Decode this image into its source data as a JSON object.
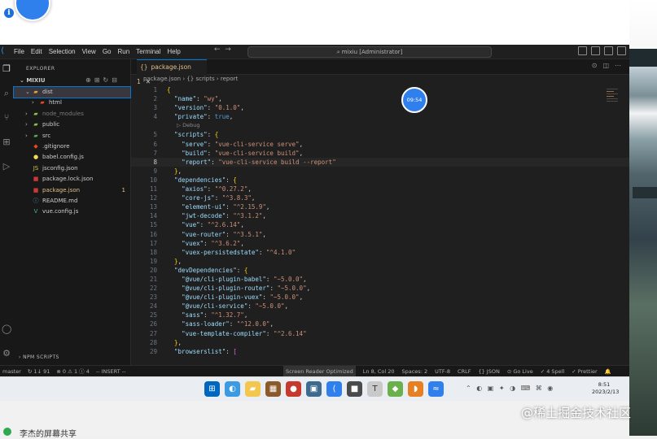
{
  "window": {
    "title": "mixiu [Administrator]",
    "menu": [
      "File",
      "Edit",
      "Selection",
      "View",
      "Go",
      "Run",
      "Terminal",
      "Help"
    ]
  },
  "sidebar": {
    "header": "EXPLORER",
    "folder": "MIXIU",
    "tree": [
      {
        "label": "dist",
        "chev": "⌄",
        "icon": "▰",
        "icon_color": "#e8a33d",
        "indent": 1,
        "active": true
      },
      {
        "label": "html",
        "chev": "›",
        "icon": "▰",
        "icon_color": "#e44d26",
        "indent": 2
      },
      {
        "label": "node_modules",
        "chev": "›",
        "icon": "▰",
        "icon_color": "#8bc34a",
        "indent": 1,
        "dim": true
      },
      {
        "label": "public",
        "chev": "›",
        "icon": "▰",
        "icon_color": "#8bc34a",
        "indent": 1
      },
      {
        "label": "src",
        "chev": "›",
        "icon": "▰",
        "icon_color": "#4caf50",
        "indent": 1
      },
      {
        "label": ".gitignore",
        "chev": "",
        "icon": "◆",
        "icon_color": "#e64a19",
        "indent": 1
      },
      {
        "label": "babel.config.js",
        "chev": "",
        "icon": "●",
        "icon_color": "#f5da55",
        "indent": 1
      },
      {
        "label": "jsconfig.json",
        "chev": "",
        "icon": "JS",
        "icon_color": "#cbcb41",
        "indent": 1
      },
      {
        "label": "package.lock.json",
        "chev": "",
        "icon": "■",
        "icon_color": "#cb3837",
        "indent": 1
      },
      {
        "label": "package.json",
        "chev": "",
        "icon": "■",
        "icon_color": "#cb3837",
        "indent": 1,
        "badge": "1",
        "modified": true
      },
      {
        "label": "README.md",
        "chev": "",
        "icon": "ⓘ",
        "icon_color": "#519aba",
        "indent": 1
      },
      {
        "label": "vue.config.js",
        "chev": "",
        "icon": "V",
        "icon_color": "#41b883",
        "indent": 1
      }
    ],
    "npm_scripts": "NPM SCRIPTS"
  },
  "editor": {
    "tab_label": "package.json 1",
    "breadcrumb": [
      "package.json",
      "{} scripts",
      "report"
    ],
    "timer": "09:54",
    "lines": [
      {
        "n": "1",
        "t": "{"
      },
      {
        "n": "2",
        "t": "  \"name\": \"wy\","
      },
      {
        "n": "3",
        "t": "  \"version\": \"0.1.0\","
      },
      {
        "n": "4",
        "t": "  \"private\": true,"
      },
      {
        "n": "",
        "t": "▷ Debug",
        "lens": true
      },
      {
        "n": "5",
        "t": "  \"scripts\": {"
      },
      {
        "n": "6",
        "t": "    \"serve\": \"vue-cli-service serve\","
      },
      {
        "n": "7",
        "t": "    \"build\": \"vue-cli-service build\","
      },
      {
        "n": "8",
        "t": "    \"report\": \"vue-cli-service build --report\"",
        "cur": true
      },
      {
        "n": "9",
        "t": "  },"
      },
      {
        "n": "10",
        "t": "  \"dependencies\": {"
      },
      {
        "n": "11",
        "t": "    \"axios\": \"^0.27.2\","
      },
      {
        "n": "12",
        "t": "    \"core-js\": \"^3.8.3\","
      },
      {
        "n": "13",
        "t": "    \"element-ui\": \"^2.15.9\","
      },
      {
        "n": "14",
        "t": "    \"jwt-decode\": \"^3.1.2\","
      },
      {
        "n": "15",
        "t": "    \"vue\": \"^2.6.14\","
      },
      {
        "n": "16",
        "t": "    \"vue-router\": \"^3.5.1\","
      },
      {
        "n": "17",
        "t": "    \"vuex\": \"^3.6.2\","
      },
      {
        "n": "18",
        "t": "    \"vuex-persistedstate\": \"^4.1.0\""
      },
      {
        "n": "19",
        "t": "  },"
      },
      {
        "n": "20",
        "t": "  \"devDependencies\": {"
      },
      {
        "n": "21",
        "t": "    \"@vue/cli-plugin-babel\": \"~5.0.0\","
      },
      {
        "n": "22",
        "t": "    \"@vue/cli-plugin-router\": \"~5.0.0\","
      },
      {
        "n": "23",
        "t": "    \"@vue/cli-plugin-vuex\": \"~5.0.0\","
      },
      {
        "n": "24",
        "t": "    \"@vue/cli-service\": \"~5.0.0\","
      },
      {
        "n": "25",
        "t": "    \"sass\": \"^1.32.7\","
      },
      {
        "n": "26",
        "t": "    \"sass-loader\": \"^12.0.0\","
      },
      {
        "n": "27",
        "t": "    \"vue-template-compiler\": \"^2.6.14\""
      },
      {
        "n": "28",
        "t": "  },"
      },
      {
        "n": "29",
        "t": "  \"browserslist\": ["
      }
    ]
  },
  "statusbar": {
    "left": [
      "master",
      "↻ 1↓ 91",
      "⊗ 0 ⚠ 1 ⓘ 4",
      "-- INSERT --"
    ],
    "right": [
      "Screen Reader Optimized",
      "Ln 8, Col 20",
      "Spaces: 2",
      "UTF-8",
      "CRLF",
      "{} JSON",
      "⊙ Go Live",
      "✓ 4 Spell",
      "✓ Prettier",
      "🔔"
    ]
  },
  "taskbar": {
    "time": "8:51",
    "date": "2023/2/13"
  },
  "overlay": {
    "watermark": "@稀土掘金技术社区",
    "share_text": "李杰的屏幕共享"
  }
}
